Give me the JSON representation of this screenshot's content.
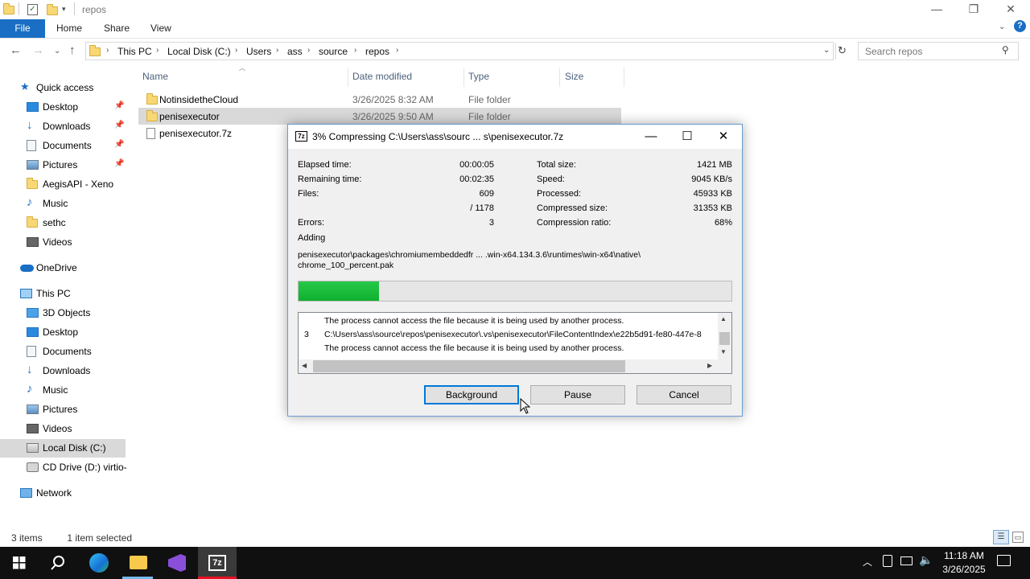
{
  "window": {
    "title": "repos"
  },
  "ribbon": {
    "file": "File",
    "tabs": [
      "Home",
      "Share",
      "View"
    ]
  },
  "address": {
    "crumbs": [
      "This PC",
      "Local Disk (C:)",
      "Users",
      "ass",
      "source",
      "repos"
    ],
    "search_placeholder": "Search repos"
  },
  "nav": {
    "quick_access": "Quick access",
    "quick_items": [
      "Desktop",
      "Downloads",
      "Documents",
      "Pictures",
      "AegisAPI - Xeno",
      "Music",
      "sethc",
      "Videos"
    ],
    "onedrive": "OneDrive",
    "this_pc": "This PC",
    "pc_items": [
      "3D Objects",
      "Desktop",
      "Documents",
      "Downloads",
      "Music",
      "Pictures",
      "Videos",
      "Local Disk (C:)",
      "CD Drive (D:) virtio-"
    ],
    "network": "Network"
  },
  "columns": {
    "name": "Name",
    "date": "Date modified",
    "type": "Type",
    "size": "Size"
  },
  "files": [
    {
      "name": "NotinsidetheCloud",
      "date": "3/26/2025 8:32 AM",
      "type": "File folder"
    },
    {
      "name": "penisexecutor",
      "date": "3/26/2025 9:50 AM",
      "type": "File folder"
    },
    {
      "name": "penisexecutor.7z",
      "date": "",
      "type": ""
    }
  ],
  "status": {
    "count": "3 items",
    "selected": "1 item selected"
  },
  "dialog": {
    "icon": "7z",
    "title": "3% Compressing C:\\Users\\ass\\sourc ... s\\penisexecutor.7z",
    "elapsed_label": "Elapsed time:",
    "elapsed": "00:00:05",
    "remaining_label": "Remaining time:",
    "remaining": "00:02:35",
    "files_label": "Files:",
    "files": "609",
    "files_total": "/ 1178",
    "errors_label": "Errors:",
    "errors": "3",
    "total_label": "Total size:",
    "total": "1421 MB",
    "speed_label": "Speed:",
    "speed": "9045 KB/s",
    "processed_label": "Processed:",
    "processed": "45933 KB",
    "compressed_label": "Compressed size:",
    "compressed": "31353 KB",
    "ratio_label": "Compression ratio:",
    "ratio": "68%",
    "adding_label": "Adding",
    "path1": "penisexecutor\\packages\\chromiumembeddedfr ... .win-x64.134.3.6\\runtimes\\win-x64\\native\\",
    "path2": "chrome_100_percent.pak",
    "progress_fraction": 0.03,
    "error_lines": [
      {
        "num": "",
        "text": "The process cannot access the file because it is being used by another process."
      },
      {
        "num": "3",
        "text": "C:\\Users\\ass\\source\\repos\\penisexecutor\\.vs\\penisexecutor\\FileContentIndex\\e22b5d91-fe80-447e-8"
      },
      {
        "num": "",
        "text": "The process cannot access the file because it is being used by another process."
      }
    ],
    "btn_background": "Background",
    "btn_pause": "Pause",
    "btn_cancel": "Cancel"
  },
  "taskbar": {
    "time": "11:18 AM",
    "date": "3/26/2025"
  }
}
